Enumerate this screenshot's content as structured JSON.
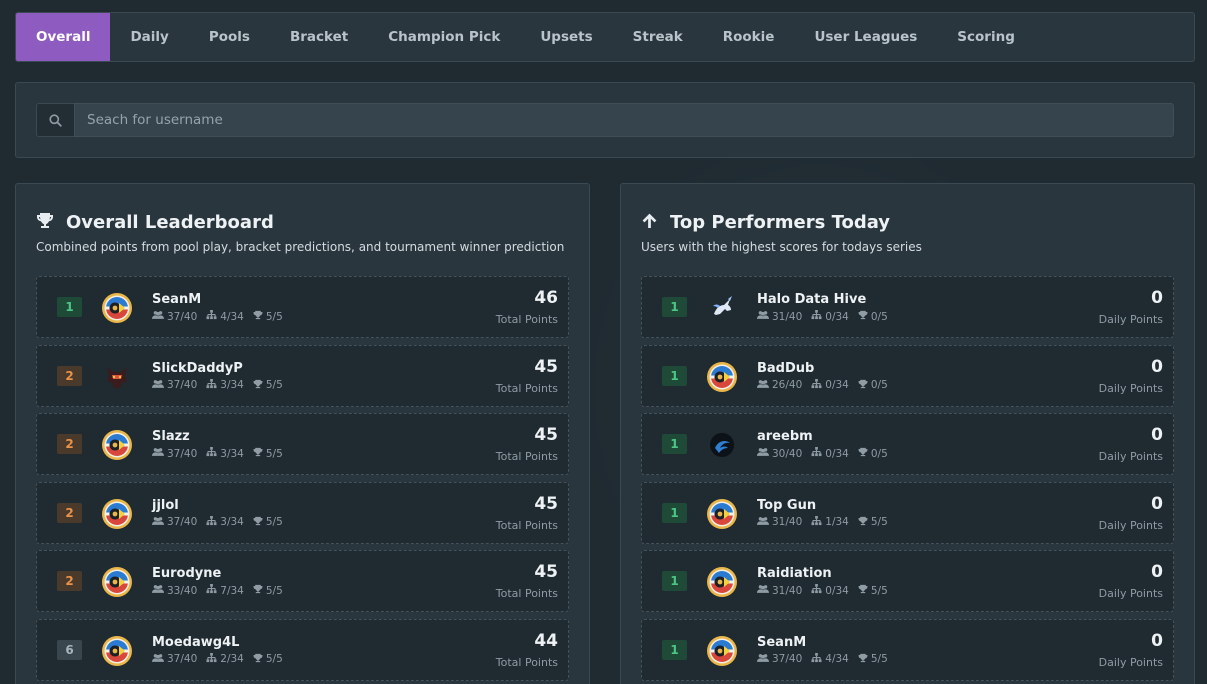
{
  "tabs": [
    {
      "label": "Overall",
      "active": true
    },
    {
      "label": "Daily",
      "active": false
    },
    {
      "label": "Pools",
      "active": false
    },
    {
      "label": "Bracket",
      "active": false
    },
    {
      "label": "Champion Pick",
      "active": false
    },
    {
      "label": "Upsets",
      "active": false
    },
    {
      "label": "Streak",
      "active": false
    },
    {
      "label": "Rookie",
      "active": false
    },
    {
      "label": "User Leagues",
      "active": false
    },
    {
      "label": "Scoring",
      "active": false
    }
  ],
  "search": {
    "placeholder": "Seach for username",
    "value": "",
    "icon": "search-icon"
  },
  "leaderboard": {
    "icon": "trophy-icon",
    "title": "Overall Leaderboard",
    "subtitle": "Combined points from pool play, bracket predictions, and tournament winner prediction",
    "rows": [
      {
        "rank": "1",
        "rank_color": "green",
        "avatar": "halo-badge-avatar",
        "username": "SeanM",
        "pools": "37/40",
        "bracket": "4/34",
        "trophies": "5/5",
        "points": "46",
        "points_label": "Total Points"
      },
      {
        "rank": "2",
        "rank_color": "orange",
        "avatar": "spartan-helmet-avatar",
        "username": "SlickDaddyP",
        "pools": "37/40",
        "bracket": "3/34",
        "trophies": "5/5",
        "points": "45",
        "points_label": "Total Points"
      },
      {
        "rank": "2",
        "rank_color": "orange",
        "avatar": "halo-badge-avatar",
        "username": "Slazz",
        "pools": "37/40",
        "bracket": "3/34",
        "trophies": "5/5",
        "points": "45",
        "points_label": "Total Points"
      },
      {
        "rank": "2",
        "rank_color": "orange",
        "avatar": "halo-badge-avatar",
        "username": "jjlol",
        "pools": "37/40",
        "bracket": "3/34",
        "trophies": "5/5",
        "points": "45",
        "points_label": "Total Points"
      },
      {
        "rank": "2",
        "rank_color": "orange",
        "avatar": "halo-badge-avatar",
        "username": "Eurodyne",
        "pools": "33/40",
        "bracket": "7/34",
        "trophies": "5/5",
        "points": "45",
        "points_label": "Total Points"
      },
      {
        "rank": "6",
        "rank_color": "gray",
        "avatar": "halo-badge-avatar",
        "username": "Moedawg4L",
        "pools": "37/40",
        "bracket": "2/34",
        "trophies": "5/5",
        "points": "44",
        "points_label": "Total Points"
      }
    ]
  },
  "performers": {
    "icon": "arrow-up-icon",
    "title": "Top Performers Today",
    "subtitle": "Users with the highest scores for todays series",
    "rows": [
      {
        "rank": "1",
        "rank_color": "green",
        "avatar": "unicorn-avatar",
        "username": "Halo Data Hive",
        "pools": "31/40",
        "bracket": "0/34",
        "trophies": "0/5",
        "points": "0",
        "points_label": "Daily Points"
      },
      {
        "rank": "1",
        "rank_color": "green",
        "avatar": "halo-badge-avatar",
        "username": "BadDub",
        "pools": "26/40",
        "bracket": "0/34",
        "trophies": "0/5",
        "points": "0",
        "points_label": "Daily Points"
      },
      {
        "rank": "1",
        "rank_color": "green",
        "avatar": "dark-orb-avatar",
        "username": "areebm",
        "pools": "30/40",
        "bracket": "0/34",
        "trophies": "0/5",
        "points": "0",
        "points_label": "Daily Points"
      },
      {
        "rank": "1",
        "rank_color": "green",
        "avatar": "halo-badge-avatar",
        "username": "Top Gun",
        "pools": "31/40",
        "bracket": "1/34",
        "trophies": "5/5",
        "points": "0",
        "points_label": "Daily Points"
      },
      {
        "rank": "1",
        "rank_color": "green",
        "avatar": "halo-badge-avatar",
        "username": "Raidiation",
        "pools": "31/40",
        "bracket": "0/34",
        "trophies": "5/5",
        "points": "0",
        "points_label": "Daily Points"
      },
      {
        "rank": "1",
        "rank_color": "green",
        "avatar": "halo-badge-avatar",
        "username": "SeanM",
        "pools": "37/40",
        "bracket": "4/34",
        "trophies": "5/5",
        "points": "0",
        "points_label": "Daily Points"
      }
    ]
  },
  "colors": {
    "accent": "#8e5cc0",
    "background": "#1f2a31",
    "panel": "#2a363e",
    "rank_green": "#4cc685",
    "rank_orange": "#e9924a"
  }
}
